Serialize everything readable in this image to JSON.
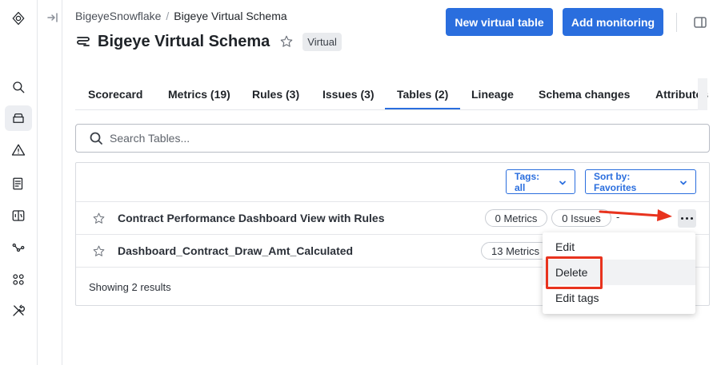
{
  "rail": {
    "items": [
      {
        "icon": "logo-icon"
      },
      {
        "icon": "search-icon"
      },
      {
        "icon": "catalog-icon",
        "active": true
      },
      {
        "icon": "alert-icon"
      },
      {
        "icon": "docs-icon"
      },
      {
        "icon": "sql-icon"
      },
      {
        "icon": "lineage-icon"
      },
      {
        "icon": "apps-icon"
      },
      {
        "icon": "tools-icon"
      }
    ]
  },
  "breadcrumb": {
    "parent": "BigeyeSnowflake",
    "separator": "/",
    "current": "Bigeye Virtual Schema"
  },
  "header": {
    "title": "Bigeye Virtual Schema",
    "badge": "Virtual",
    "new_virtual_table": "New virtual table",
    "add_monitoring": "Add monitoring"
  },
  "tabs": [
    {
      "label": "Scorecard"
    },
    {
      "label": "Metrics (19)"
    },
    {
      "label": "Rules (3)"
    },
    {
      "label": "Issues (3)"
    },
    {
      "label": "Tables (2)",
      "active": true
    },
    {
      "label": "Lineage"
    },
    {
      "label": "Schema changes"
    },
    {
      "label": "Attributes"
    }
  ],
  "search": {
    "placeholder": "Search Tables...",
    "value": ""
  },
  "toolbar": {
    "tags": "Tags: all",
    "sort": "Sort by: Favorites"
  },
  "rows": [
    {
      "name": "Contract Performance Dashboard View with Rules",
      "metrics": "0 Metrics",
      "issues": "0 Issues",
      "extra": "-"
    },
    {
      "name": "Dashboard_Contract_Draw_Amt_Calculated",
      "metrics": "13 Metrics"
    }
  ],
  "footer": {
    "results": "Showing 2 results"
  },
  "menu": {
    "edit": "Edit",
    "delete": "Delete",
    "edit_tags": "Edit tags"
  },
  "colors": {
    "accent": "#2a6ede",
    "annotation": "#e8331e"
  }
}
